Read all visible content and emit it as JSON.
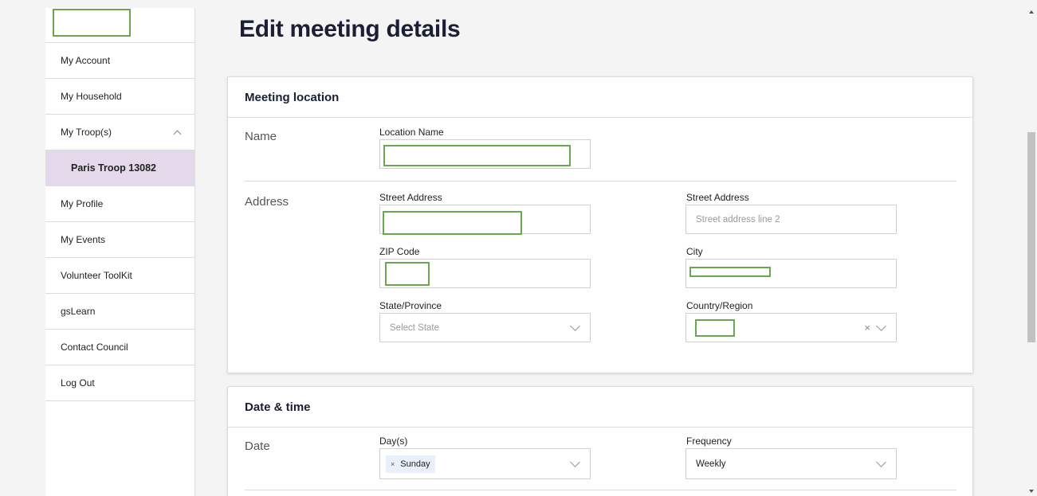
{
  "sidebar": {
    "items": [
      {
        "label": "My Account"
      },
      {
        "label": "My Household"
      },
      {
        "label": "My Troop(s)"
      },
      {
        "label": "Paris Troop 13082"
      },
      {
        "label": "My Profile"
      },
      {
        "label": "My Events"
      },
      {
        "label": "Volunteer ToolKit"
      },
      {
        "label": "gsLearn"
      },
      {
        "label": "Contact Council"
      },
      {
        "label": "Log Out"
      }
    ]
  },
  "page": {
    "title": "Edit meeting details"
  },
  "location": {
    "header": "Meeting location",
    "name_row_label": "Name",
    "address_row_label": "Address",
    "location_name_label": "Location Name",
    "street1_label": "Street Address",
    "street2_label": "Street Address",
    "street2_placeholder": "Street address line 2",
    "zip_label": "ZIP Code",
    "city_label": "City",
    "state_label": "State/Province",
    "state_placeholder": "Select State",
    "country_label": "Country/Region",
    "country_clear": "×"
  },
  "datetime": {
    "header": "Date & time",
    "date_row_label": "Date",
    "days_label": "Day(s)",
    "day_tag": "Sunday",
    "day_tag_remove": "×",
    "frequency_label": "Frequency",
    "frequency_value": "Weekly"
  },
  "colors": {
    "accent_purple_bg": "#e3d9ea",
    "redaction_green": "#6aa84f",
    "title_navy": "#1a1f36"
  }
}
